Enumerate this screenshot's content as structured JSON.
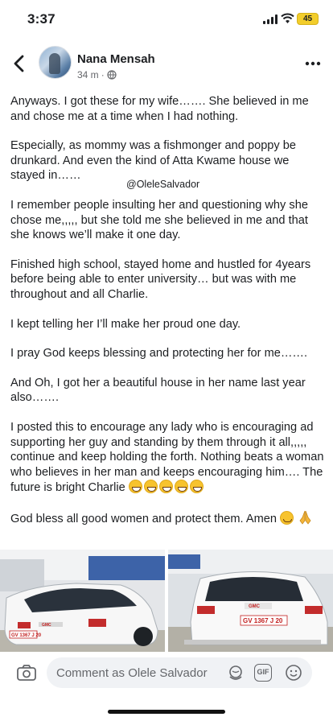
{
  "status_bar": {
    "time": "3:37",
    "battery": "45"
  },
  "post": {
    "author": "Nana Mensah",
    "time_ago": "34 m",
    "separator": "·",
    "watermark": "@OleleSalvador",
    "paragraphs": [
      "Anyways. I got these for my wife……. She believed in me and chose me at a time when I had nothing.",
      "Especially, as mommy was a fishmonger and poppy be drunkard. And even the kind of Atta Kwame house we stayed in……",
      "I remember people insulting her and questioning why she chose me,,,,, but she told me she believed in me and that she knows we’ll make it one day.",
      "Finished high school, stayed home and hustled for 4years before being able to enter university… but was with me throughout and all Charlie.",
      "I kept telling her I’ll make her proud one day.",
      "I pray God keeps blessing and protecting her for me…….",
      "And Oh, I got her a beautiful house in her name last year also…….",
      "I posted this to encourage any lady who is encouraging ad supporting her guy and standing by them through it all,,,,, continue and keep holding the forth. Nothing beats a woman who believes in her man and keeps encouraging him…. The future is bright Charlie",
      "God bless all good women and protect them. Amen"
    ],
    "photos": [
      {
        "brand": "GMC",
        "plate": "GV 1367 J 20"
      },
      {
        "brand": "GMC",
        "plate": "GV 1367 J 20"
      }
    ]
  },
  "comment_bar": {
    "placeholder": "Comment as Olele Salvador",
    "gif_label": "GIF"
  },
  "icons": [
    "back-arrow-icon",
    "globe-icon",
    "more-icon",
    "camera-icon",
    "avatar-sticker-icon",
    "gif-icon",
    "emoji-icon",
    "grinning-emoji",
    "smiling-emoji",
    "folded-hands-emoji"
  ],
  "colors": {
    "text": "#1c1e21",
    "secondary": "#65676b",
    "input_bg": "#f0f2f5",
    "battery": "#f2cd2b"
  }
}
